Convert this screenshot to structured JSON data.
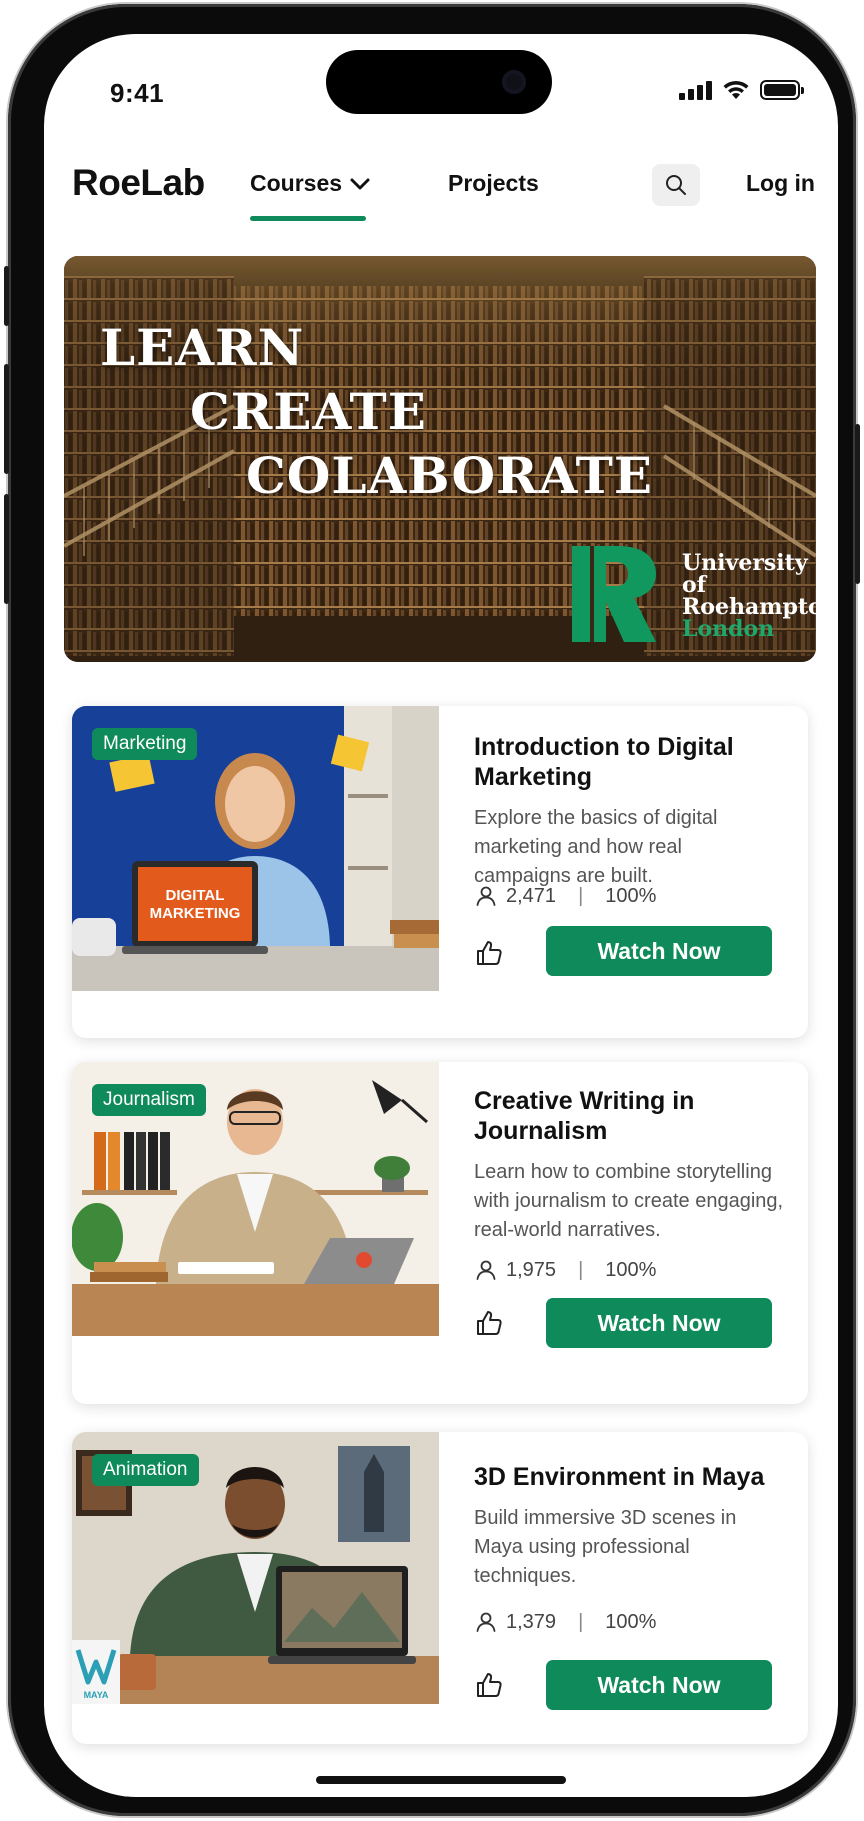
{
  "status_bar": {
    "time": "9:41"
  },
  "nav": {
    "brand": "RoeLab",
    "courses_label": "Courses",
    "projects_label": "Projects",
    "login_label": "Log in",
    "search_icon": "search-icon",
    "accent_color": "#0f8a5a"
  },
  "hero": {
    "line1": "LEARN",
    "line2": "CREATE",
    "line3": "COLABORATE",
    "university_line1": "University of",
    "university_line2": "Roehampton",
    "university_line3": "London"
  },
  "courses": [
    {
      "tag": "Marketing",
      "title": "Introduction to Digital Marketing",
      "description": "Explore the basics of digital marketing and how real campaigns are built.",
      "students": "2,471",
      "rating": "100%",
      "button": "Watch Now",
      "screen_text_1": "DIGITAL",
      "screen_text_2": "MARKETING"
    },
    {
      "tag": "Journalism",
      "title": "Creative Writing in Journalism",
      "description": "Learn how to combine storytelling with journalism to create engaging, real-world narratives.",
      "students": "1,975",
      "rating": "100%",
      "button": "Watch Now"
    },
    {
      "tag": "Animation",
      "title": "3D Environment in Maya",
      "description": "Build immersive 3D scenes in Maya using professional techniques.",
      "students": "1,379",
      "rating": "100%",
      "button": "Watch Now",
      "logo_text": "MAYA"
    }
  ]
}
